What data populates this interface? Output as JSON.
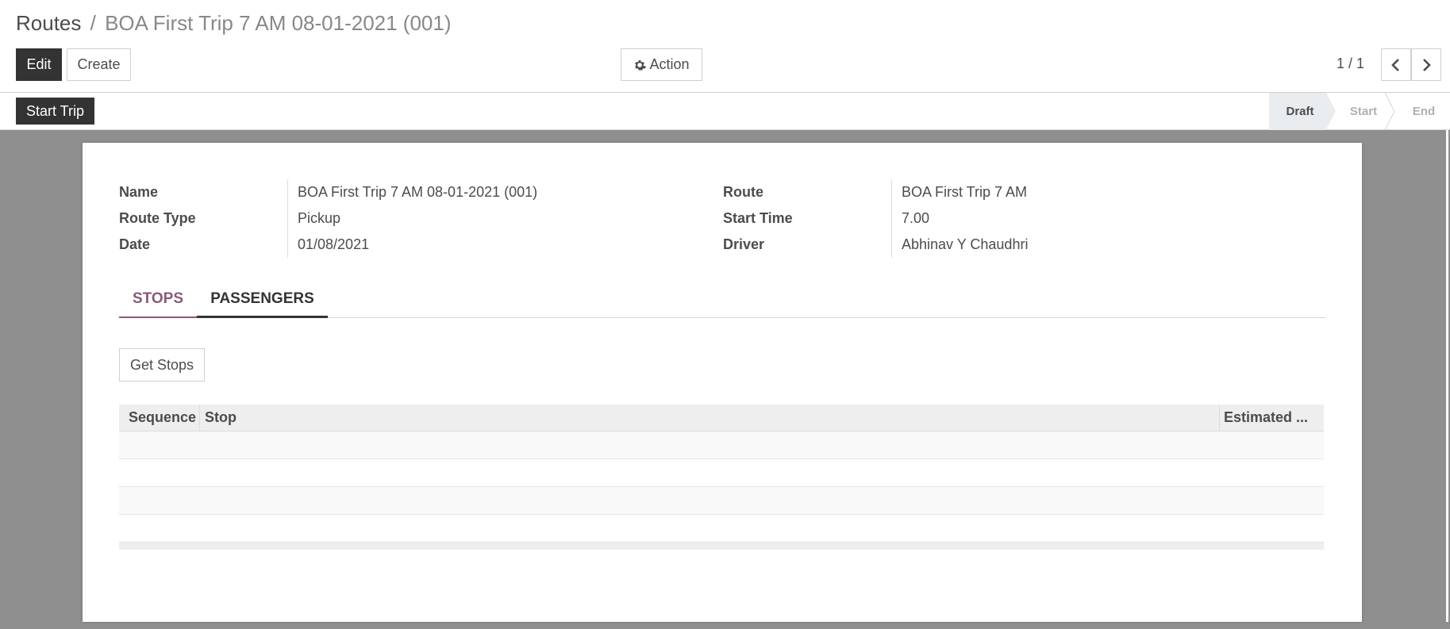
{
  "breadcrumb": {
    "parent": "Routes",
    "separator": "/",
    "current": "BOA First Trip 7 AM 08-01-2021 (001)"
  },
  "toolbar": {
    "edit_label": "Edit",
    "create_label": "Create",
    "action_label": "Action",
    "action_icon": "gear-icon"
  },
  "pager": {
    "value": "1 / 1"
  },
  "statusbar": {
    "start_trip_label": "Start Trip",
    "stages": [
      "Draft",
      "Start",
      "End"
    ],
    "active_stage": "Draft"
  },
  "form": {
    "left": [
      {
        "label": "Name",
        "value": "BOA First Trip 7 AM 08-01-2021 (001)"
      },
      {
        "label": "Route Type",
        "value": "Pickup"
      },
      {
        "label": "Date",
        "value": "01/08/2021"
      }
    ],
    "right": [
      {
        "label": "Route",
        "value": "BOA First Trip 7 AM"
      },
      {
        "label": "Start Time",
        "value": "7.00"
      },
      {
        "label": "Driver",
        "value": "Abhinav Y Chaudhri"
      }
    ]
  },
  "tabs": {
    "stops": "STOPS",
    "passengers": "PASSENGERS"
  },
  "stops_tab": {
    "get_stops_label": "Get Stops",
    "columns": [
      "Sequence",
      "Stop",
      "Estimated ..."
    ],
    "rows": []
  },
  "colors": {
    "primary_dark": "#333333",
    "accent": "#875a7b",
    "background": "#8f8f8f"
  }
}
